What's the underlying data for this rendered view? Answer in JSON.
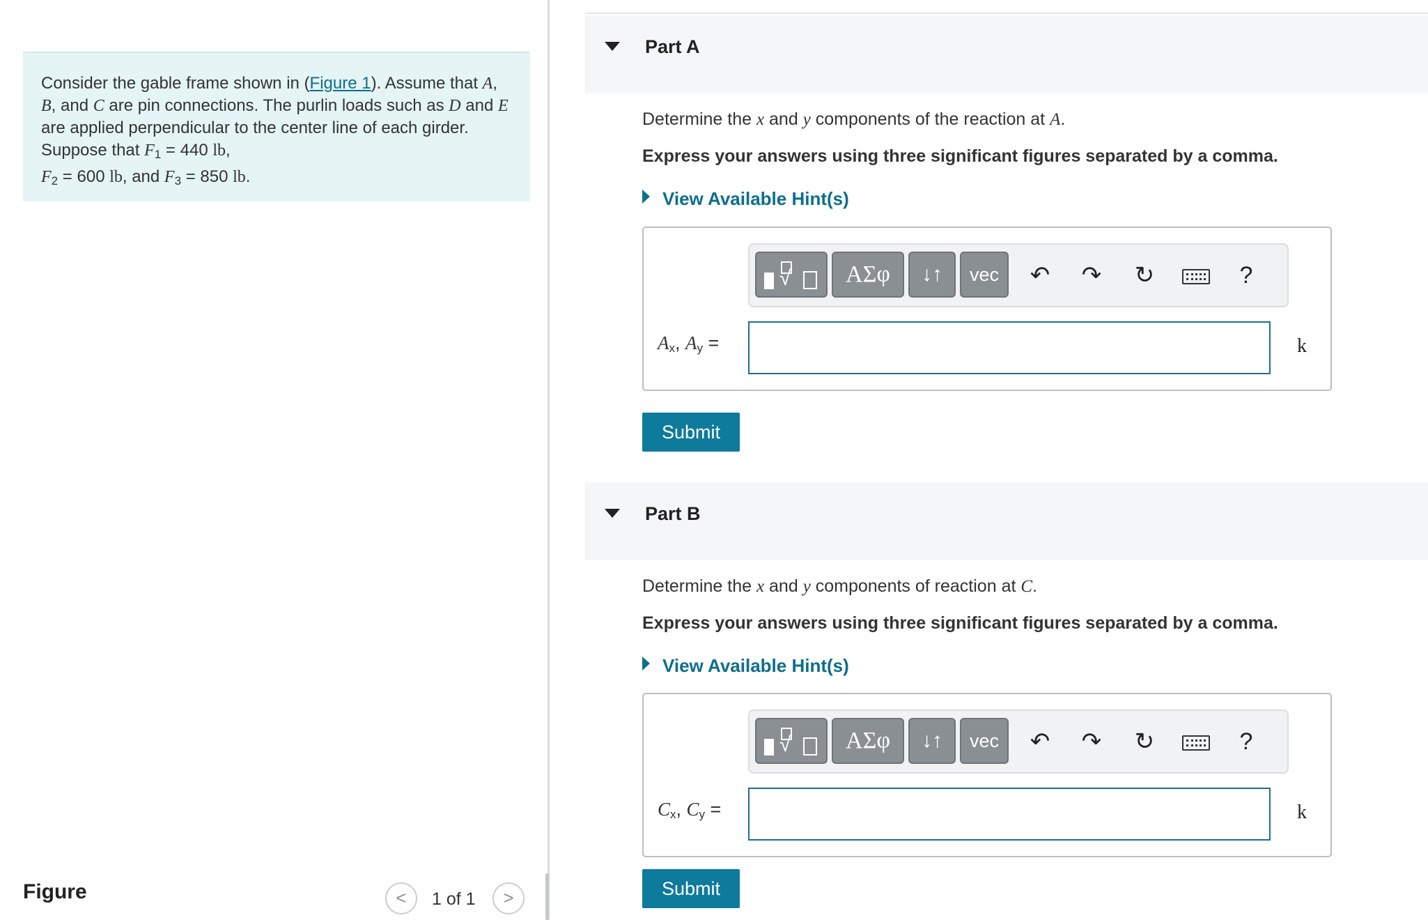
{
  "intro": {
    "t1": "Consider the gable frame shown in (",
    "figure_link": "Figure 1",
    "t2": "). Assume that ",
    "A": "A",
    "comma1": ", ",
    "B": "B",
    "t3": ", and ",
    "C": "C",
    "t4": " are pin connections. The purlin loads such as ",
    "D": "D",
    "t5": " and ",
    "E": "E",
    "t6": " are applied perpendicular to the center line of each girder. Suppose that ",
    "F": "F",
    "sub1": "1",
    "eq1": " = 440 ",
    "unit1": "lb",
    "comma2": ",",
    "sub2": "2",
    "eq2": " = 600 ",
    "unit2": "lb",
    "t7": ", and ",
    "sub3": "3",
    "eq3": " = 850 ",
    "unit3": "lb",
    "period": "."
  },
  "figure_panel": {
    "title": "Figure",
    "pager": "1 of 1",
    "prev_icon": "<",
    "next_icon": ">"
  },
  "toolbar": {
    "greek": "ΑΣφ",
    "arrows": "↓↑",
    "vec": "vec",
    "undo": "↶",
    "redo": "↷",
    "reset": "↻",
    "help": "?"
  },
  "partA": {
    "title": "Part A",
    "q1": "Determine the ",
    "x": "x",
    "q2": " and ",
    "y": "y",
    "q3": " components of the reaction at ",
    "point": "A",
    "q4": ".",
    "instruction": "Express your answers using three significant figures separated by a comma.",
    "hint": "View Available Hint(s)",
    "label_var": "A",
    "label_sub_x": "x",
    "label_sep": ", ",
    "label_sub_y": "y",
    "label_eq": " =",
    "input_value": "",
    "unit": "k",
    "submit": "Submit"
  },
  "partB": {
    "title": "Part B",
    "q1": "Determine the ",
    "x": "x",
    "q2": " and ",
    "y": "y",
    "q3": " components of reaction at ",
    "point": "C",
    "q4": ".",
    "instruction": "Express your answers using three significant figures separated by a comma.",
    "hint": "View Available Hint(s)",
    "label_var": "C",
    "label_sub_x": "x",
    "label_sep": ", ",
    "label_sub_y": "y",
    "label_eq": " =",
    "input_value": "",
    "unit": "k",
    "submit": "Submit"
  }
}
